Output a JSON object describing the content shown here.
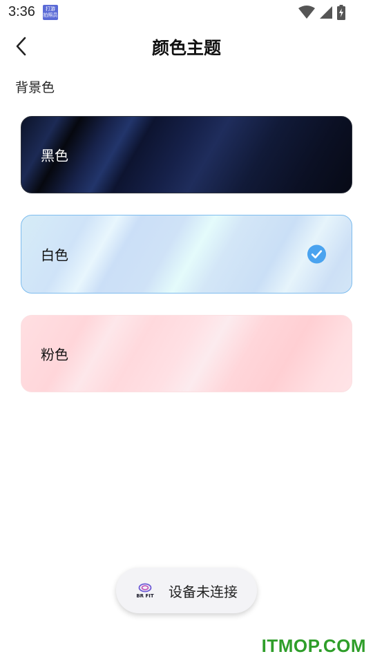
{
  "status_bar": {
    "time": "3:36",
    "app_icon_text": "打游\n拍照员",
    "icons": [
      "wifi-icon",
      "signal-icon",
      "battery-charging-icon"
    ]
  },
  "header": {
    "title": "颜色主题",
    "back_icon": "chevron-left-icon"
  },
  "section": {
    "label": "背景色"
  },
  "themes": [
    {
      "label": "黑色",
      "selected": false
    },
    {
      "label": "白色",
      "selected": true
    },
    {
      "label": "粉色",
      "selected": false
    }
  ],
  "toast": {
    "logo_text": "BR FIT",
    "message": "设备未连接"
  },
  "watermark": "ITMOP.COM",
  "colors": {
    "accent": "#4aa3ef",
    "watermark": "#2f9e2a"
  }
}
